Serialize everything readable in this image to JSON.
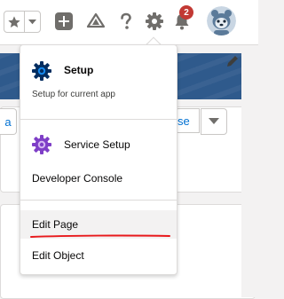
{
  "header": {
    "favorites_icon": "star-icon",
    "favorites_caret_icon": "caret-down-icon",
    "add_icon": "plus-icon",
    "trailhead_icon": "trailhead-icon",
    "help_icon": "question-mark-icon",
    "setup_icon": "gear-icon",
    "notifications_icon": "bell-icon",
    "notification_count": "2",
    "avatar_icon": "avatar-icon"
  },
  "background": {
    "left_button_text": "a",
    "right_button_text": "se"
  },
  "menu": {
    "setup": {
      "title": "Setup",
      "subtitle": "Setup for current app"
    },
    "service_setup": {
      "label": "Service Setup"
    },
    "developer_console": {
      "label": "Developer Console"
    },
    "edit_page": {
      "label": "Edit Page"
    },
    "edit_object": {
      "label": "Edit Object"
    }
  },
  "colors": {
    "accent": "#0070d2",
    "setup_icon_color": "#032d60",
    "service_icon_color": "#7f3fc7",
    "badge": "#c23934",
    "annotation_red": "#e8191c"
  }
}
